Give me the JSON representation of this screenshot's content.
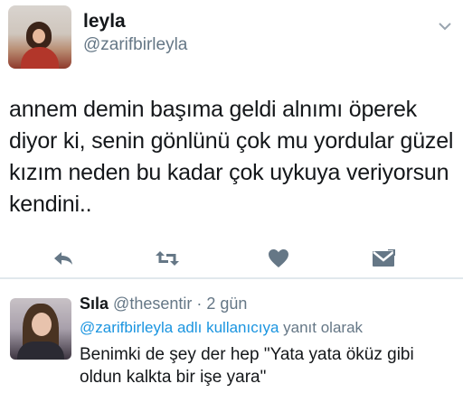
{
  "tweet": {
    "name": "leyla",
    "handle": "@zarifbirleyla",
    "text": "annem demin başıma geldi alnımı öperek diyor ki, senin gönlünü çok mu yordular güzel kızım neden bu kadar çok uykuya veriyorsun kendini..",
    "menu_icon": "chevron-down-icon",
    "actions": [
      {
        "name": "reply",
        "icon": "reply-icon"
      },
      {
        "name": "retweet",
        "icon": "retweet-icon"
      },
      {
        "name": "like",
        "icon": "heart-icon"
      },
      {
        "name": "direct-message",
        "icon": "envelope-icon"
      }
    ]
  },
  "reply": {
    "name": "Sıla",
    "handle": "@thesentir",
    "separator": "·",
    "time": "2 gün",
    "replying_to_link": "@zarifbirleyla adlı kullanıcıya",
    "replying_to_rest": "yanıt olarak",
    "text": "Benimki de şey der hep \"Yata yata öküz gibi oldun kalkta bir işe yara\""
  },
  "colors": {
    "icon": "#657786",
    "link": "#1b95e0",
    "divider": "#e1e8ed",
    "text": "#14171a"
  }
}
